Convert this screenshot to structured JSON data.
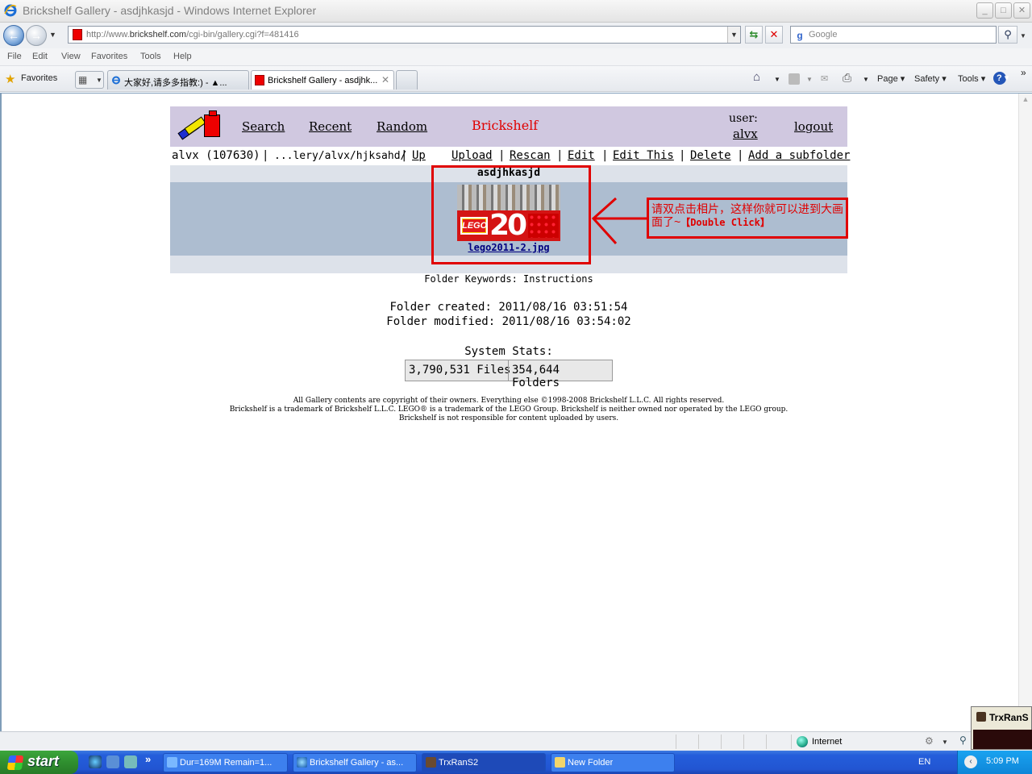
{
  "window": {
    "title": "Brickshelf Gallery - asdjhkasjd - Windows Internet Explorer",
    "minimize": "_",
    "maximize": "□",
    "close": "✕"
  },
  "address": {
    "url_prefix": "http://www.",
    "url_domain": "brickshelf.com",
    "url_path": "/cgi-bin/gallery.cgi?f=481416",
    "search_placeholder": "Google"
  },
  "menu": [
    "File",
    "Edit",
    "View",
    "Favorites",
    "Tools",
    "Help"
  ],
  "favorites": {
    "label": "Favorites"
  },
  "tabs": [
    {
      "label": "大家好,请多多指教:) - ▲..."
    },
    {
      "label": "Brickshelf Gallery - asdjhk...",
      "close": "✕"
    }
  ],
  "commands": {
    "page": "Page ▾",
    "safety": "Safety ▾",
    "tools": "Tools ▾",
    "help": "? ▾",
    "more": "»"
  },
  "site_header": {
    "nav": [
      "Search",
      "Recent",
      "Random"
    ],
    "brand": "Brickshelf",
    "user_label": "user:",
    "username": "alvx",
    "logout": "logout"
  },
  "crumbs": {
    "owner": "alvx (107630)",
    "path": "...lery/alvx/hjksahd/",
    "actions": [
      "Up",
      "Upload",
      "Rescan",
      "Edit",
      "Edit This",
      "Delete",
      "Add a subfolder"
    ],
    "separator": "|"
  },
  "folder": {
    "name": "asdjhkasjd",
    "image_filename": "lego2011-2.jpg",
    "thumb_logo_text": "LEGO",
    "thumb_number": "20",
    "keywords": "Folder Keywords: Instructions",
    "created": "Folder created: 2011/08/16 03:51:54",
    "modified": "Folder modified: 2011/08/16 03:54:02"
  },
  "annotation": {
    "text": "请双点击相片，这样你就可以进到大画面了~",
    "emphasis": "【Double Click】"
  },
  "stats": {
    "label": "System Stats:",
    "files": "3,790,531 Files",
    "folders": "354,644 Folders"
  },
  "copyright": [
    "All Gallery contents are copyright of their owners. Everything else ©1998-2008 Brickshelf L.L.C. All rights reserved.",
    "Brickshelf is a trademark of Brickshelf L.L.C. LEGO® is a trademark of the LEGO Group. Brickshelf is neither owned nor operated by the LEGO group.",
    "Brickshelf is not responsible for content uploaded by users."
  ],
  "statusbar": {
    "zone": "Internet"
  },
  "popup": {
    "title": "TrxRanS"
  },
  "taskbar": {
    "start": "start",
    "more": "»",
    "tasks": [
      "Dur=169M Remain=1...",
      "Brickshelf Gallery - as...",
      "TrxRanS2",
      "New Folder"
    ],
    "lang": "EN",
    "tray_chevron": "‹",
    "clock": "5:09 PM"
  },
  "colors": {
    "header_bg": "#d0c8e0",
    "brand_red": "#e00000",
    "band_light": "#dde2ea",
    "band_dark": "#adbdd0",
    "taskbar_blue": "#245edb"
  }
}
